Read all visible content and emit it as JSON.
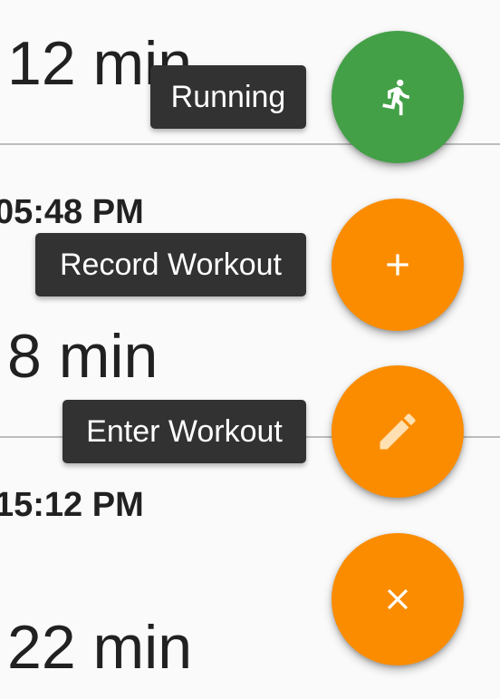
{
  "list": {
    "entries": [
      {
        "duration": "12 min"
      },
      {
        "time": "05:48 PM",
        "duration": "8 min"
      },
      {
        "time": "15:12 PM",
        "duration": "22 min"
      }
    ]
  },
  "speed_dial": {
    "main_action": {
      "label": "Running",
      "icon": "running-icon",
      "color": "#43a047"
    },
    "actions": [
      {
        "label": "Record Workout",
        "icon": "plus-icon",
        "color": "#fb8c00"
      },
      {
        "label": "Enter Workout",
        "icon": "pencil-icon",
        "color": "#fb8c00"
      }
    ],
    "close": {
      "icon": "close-icon",
      "color": "#fb8c00"
    }
  }
}
